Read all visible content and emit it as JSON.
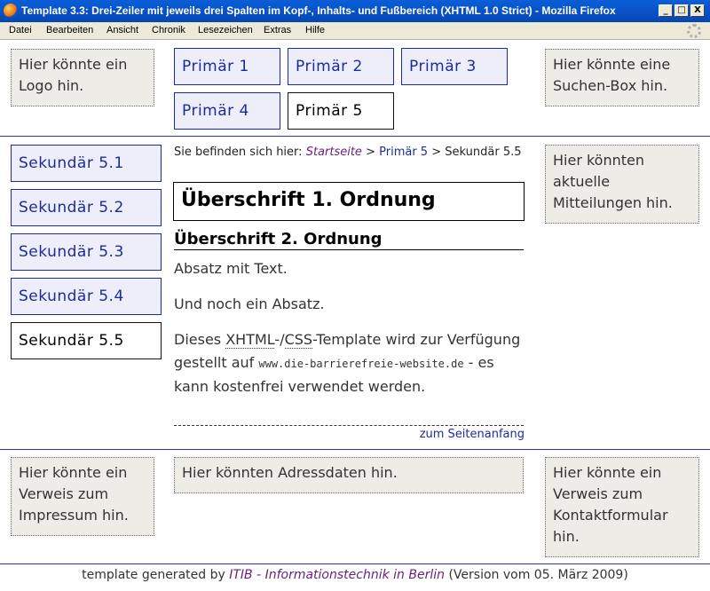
{
  "window": {
    "title": "Template 3.3: Drei-Zeiler mit jeweils drei Spalten im Kopf-, Inhalts- und Fußbereich (XHTML 1.0 Strict) - Mozilla Firefox",
    "controls": {
      "minimize": "_",
      "maximize": "□",
      "close": "X"
    }
  },
  "menu": [
    "Datei",
    "Bearbeiten",
    "Ansicht",
    "Chronik",
    "Lesezeichen",
    "Extras",
    "Hilfe"
  ],
  "header": {
    "logo_text": "Hier könnte ein Logo hin.",
    "search_text": "Hier könnte eine Suchen-Box hin.",
    "primary_nav": [
      "Primär 1",
      "Primär 2",
      "Primär 3",
      "Primär 4",
      "Primär 5"
    ]
  },
  "sidebar": {
    "secondary_nav": [
      "Sekundär 5.1",
      "Sekundär 5.2",
      "Sekundär 5.3",
      "Sekundär 5.4",
      "Sekundär 5.5"
    ]
  },
  "breadcrumb": {
    "prefix": "Sie befinden sich hier:",
    "home": "Startseite",
    "sep": ">",
    "level1": "Primär 5",
    "current": "Sekundär 5.5"
  },
  "main": {
    "h1": "Überschrift 1. Ordnung",
    "h2": "Überschrift 2. Ordnung",
    "p1": "Absatz mit Text.",
    "p2": "Und noch ein Absatz.",
    "p3_a": "Dieses",
    "p3_xhtml": "XHTML",
    "p3_dash": "-/",
    "p3_css": "CSS",
    "p3_b": "-Template wird zur Verfügung gestellt auf",
    "p3_url": "www.die-barrierefreie-website.de",
    "p3_c": "- es kann kostenfrei verwendet werden.",
    "top_link": "zum Seitenanfang"
  },
  "news_text": "Hier könnten aktuelle Mitteilungen hin.",
  "footer": {
    "impressum_text": "Hier könnte ein Verweis zum Impressum hin.",
    "address_text": "Hier könnten Adressdaten hin.",
    "contact_text": "Hier könnte ein Verweis zum Kontaktformular hin.",
    "credit_prefix": "template generated by",
    "credit_link": "ITIB - Informationstechnik in Berlin",
    "credit_suffix": "(Version vom 05. März 2009)"
  }
}
